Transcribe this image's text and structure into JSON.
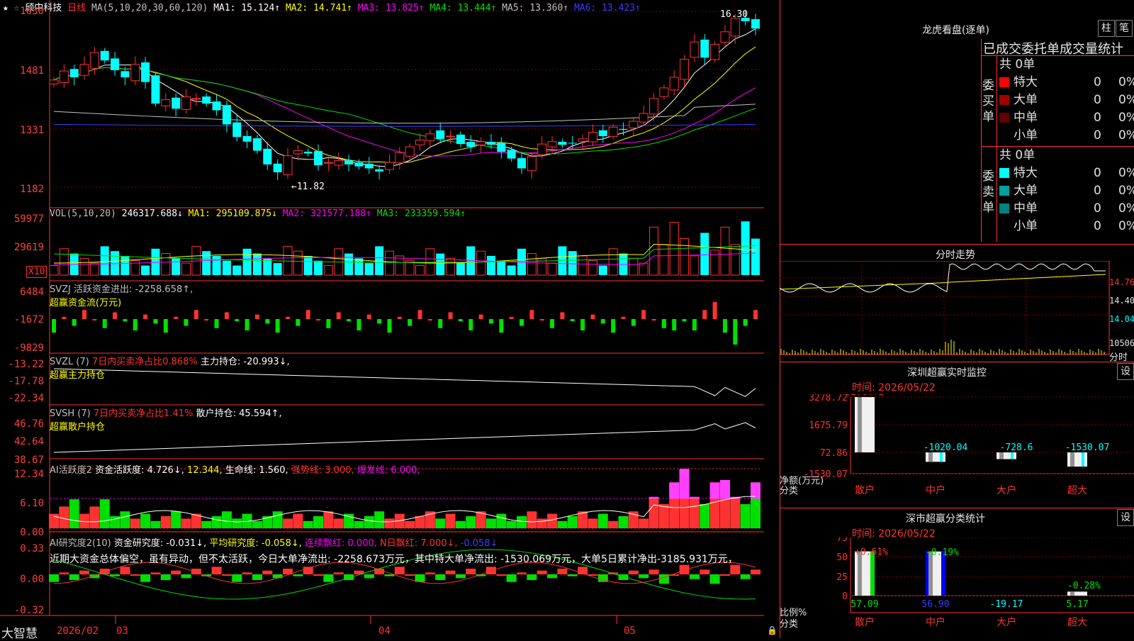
{
  "header": {
    "stock_name": "颀中科技",
    "period": "日线",
    "ma_prefix": "MA(5,10,20,30,60,120)",
    "ma1": "MA1: 15.124↑",
    "ma2": "MA2: 14.741↑",
    "ma3": "MA3: 13.825↑",
    "ma4": "MA4: 13.444↑",
    "ma5": "MA5: 13.360↑",
    "ma6": "MA6: 13.423↑",
    "high_label": "16.30",
    "low_label": "←11.82"
  },
  "main_yaxis": [
    "1630",
    "1481",
    "1331",
    "1182"
  ],
  "vol": {
    "prefix": "VOL(5,10,20)",
    "v": "246317.688↓",
    "ma1": "MA1: 295109.875↓",
    "ma2": "MA2: 321577.188↑",
    "ma3": "MA3: 233359.594↑",
    "yaxis": [
      "59977",
      "29619"
    ],
    "unit": "X10"
  },
  "svzj": {
    "line1": "SVZJ  活跃资金进出: -2258.658↑,",
    "line2": "超赢资金流(万元)",
    "yaxis": [
      "6484",
      "-1672",
      "-9829"
    ]
  },
  "svzl": {
    "line1a": "SVZL (7)",
    "line1b": "7日内买卖净占比0.868%",
    "line1c": "主力持仓: -20.993↓,",
    "line2": "超赢主力持仓",
    "yaxis": [
      "-13.22",
      "-17.78",
      "-22.34"
    ]
  },
  "svsh": {
    "line1a": "SVSH (7)",
    "line1b": "7日内买卖净占比1.41%",
    "line1c": "散户持仓: 45.594↑,",
    "line2": "超赢散户持仓",
    "yaxis": [
      "46.76",
      "42.64",
      "38.67"
    ]
  },
  "ai_act": {
    "a": "AI活跃度2",
    "b": "资金活跃度: 4.726↓,",
    "c": "12.344,",
    "d": "生命线: 1.560,",
    "e": "强势线: 3.000,",
    "f": "爆发线: 6.000,",
    "yaxis": [
      "12.34",
      "6.10",
      "0.00"
    ]
  },
  "ai_res": {
    "a": "AI研究度2(10)",
    "b": "资金研究度: -0.031↓,",
    "c": "平均研究度: -0.058↓,",
    "d": "连续飘红: 0.000,",
    "e": "N日飘红: 7.000↓,",
    "f": "-0.058↓",
    "summary": "近期大资金总体偏空，虽有异动，但不太活跃，今日大单净流出: -2258.673万元，其中特大单净流出: -1530.069万元，大单5日累计净出-3185.931万元，",
    "yaxis": [
      "0.33",
      "0.00",
      "-0.32"
    ]
  },
  "bottom": {
    "brand": "大智慧",
    "date_start": "2026/02",
    "months": [
      "03",
      "04",
      "05"
    ]
  },
  "dragon": {
    "title": "龙虎看盘(逐单)",
    "btn1": "柱",
    "btn2": "笔",
    "tabs": "已成交委托单成交量统计",
    "buy_label": "委买单",
    "sell_label": "委卖单",
    "buy_total": "共 0单",
    "sell_total": "共 0单",
    "buy_rows": [
      {
        "name": "特大",
        "color": "#ff0000",
        "n": "0",
        "pct": "0%"
      },
      {
        "name": "大单",
        "color": "#a00000",
        "n": "0",
        "pct": "0%"
      },
      {
        "name": "中单",
        "color": "#600000",
        "n": "0",
        "pct": "0%"
      },
      {
        "name": "小单",
        "color": "#000000",
        "n": "0",
        "pct": "0%"
      }
    ],
    "sell_rows": [
      {
        "name": "特大",
        "color": "#00ffff",
        "n": "0",
        "pct": "0%"
      },
      {
        "name": "大单",
        "color": "#00a0a0",
        "n": "0",
        "pct": "0%"
      },
      {
        "name": "中单",
        "color": "#008080",
        "n": "0",
        "pct": "0%"
      },
      {
        "name": "小单",
        "color": "#000000",
        "n": "0",
        "pct": "0%"
      }
    ]
  },
  "fenshi": {
    "title": "分时走势",
    "yaxis": [
      "14.76",
      "14.40",
      "14.04"
    ],
    "vol_label": "10506",
    "time_label": "分时"
  },
  "monitor": {
    "title": "深圳超赢实时监控",
    "btn": "设",
    "time": "时间: 2026/05/22",
    "yaxis": [
      "3278.72",
      "1675.79",
      "72.86",
      "-1530.07"
    ],
    "ylabel1": "净额(万元)",
    "ylabel2": "分类",
    "bars": [
      {
        "cat": "散户",
        "value": 3278.72,
        "label": "3278.72"
      },
      {
        "cat": "中户",
        "value": -1020.04,
        "label": "-1020.04"
      },
      {
        "cat": "大户",
        "value": -728.6,
        "label": "-728.6"
      },
      {
        "cat": "超大",
        "value": -1530.07,
        "label": "-1530.07"
      }
    ]
  },
  "classify": {
    "title": "深市超赢分类统计",
    "btn": "设",
    "time": "时间: 2026/05/22",
    "yaxis": [
      "75",
      "50",
      "25",
      "0"
    ],
    "ylabel1": "比例%",
    "ylabel2": "分类",
    "bars": [
      {
        "cat": "散户",
        "pct": "+0.61%",
        "value": "57.09"
      },
      {
        "cat": "中户",
        "pct": "-0.19%",
        "value": "56.90"
      },
      {
        "cat": "大户",
        "pct": "",
        "value": "-19.17"
      },
      {
        "cat": "超大",
        "pct": "-0.28%",
        "value": "5.17"
      }
    ]
  },
  "chart_data": [
    {
      "type": "candlestick",
      "title": "颀中科技 日线",
      "ylim": [
        11.5,
        16.5
      ],
      "yticks": [
        16.3,
        14.81,
        13.31,
        11.82
      ],
      "series": [
        {
          "name": "close",
          "values": [
            14.55,
            14.78,
            14.62,
            14.95,
            15.25,
            15.05,
            14.8,
            14.62,
            14.95,
            14.5,
            13.95,
            14.05,
            13.82,
            14.12,
            14.08,
            13.95,
            13.78,
            13.42,
            13.1,
            12.98,
            12.75,
            12.4,
            12.2,
            12.62,
            12.75,
            12.68,
            12.38,
            12.45,
            12.5,
            12.4,
            12.35,
            12.3,
            12.22,
            12.45,
            12.7,
            12.85,
            13.02,
            13.18,
            13.05,
            13.12,
            12.92,
            12.85,
            12.98,
            12.9,
            12.72,
            12.55,
            12.3,
            12.6,
            12.92,
            12.98,
            12.9,
            12.95,
            13.05,
            13.22,
            13.12,
            13.35,
            13.28,
            13.5,
            13.7,
            14.08,
            14.35,
            14.62,
            15.08,
            15.52,
            15.12,
            15.46,
            15.78,
            16.12,
            16.05,
            15.86
          ]
        }
      ]
    },
    {
      "type": "bar",
      "title": "VOL",
      "ylim": [
        0,
        65000
      ]
    },
    {
      "type": "bar",
      "title": "超赢资金流(万元)",
      "ylim": [
        -9829,
        6484
      ]
    },
    {
      "type": "line",
      "title": "超赢主力持仓",
      "ylim": [
        -22.34,
        -13.22
      ]
    },
    {
      "type": "line",
      "title": "超赢散户持仓",
      "ylim": [
        38.67,
        46.76
      ]
    },
    {
      "type": "bar",
      "title": "AI活跃度2",
      "ylim": [
        0,
        12.34
      ]
    },
    {
      "type": "bar",
      "title": "AI研究度2",
      "ylim": [
        -0.32,
        0.33
      ]
    }
  ],
  "colors": {
    "up": "#ff3232",
    "down": "#00ffff",
    "grid": "#8b0000"
  }
}
